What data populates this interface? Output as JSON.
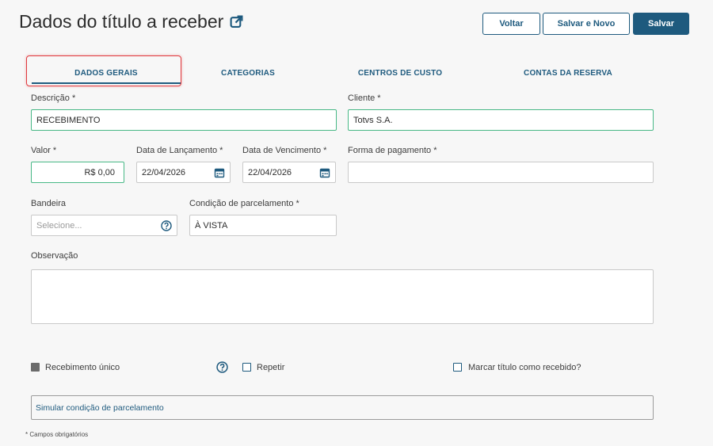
{
  "header": {
    "title": "Dados do título a receber",
    "external_link_icon": "external-link-icon",
    "buttons": {
      "back": "Voltar",
      "save_new": "Salvar e Novo",
      "save": "Salvar"
    }
  },
  "tabs": [
    {
      "label": "DADOS GERAIS",
      "active": true
    },
    {
      "label": "CATEGORIAS",
      "active": false
    },
    {
      "label": "CENTROS DE CUSTO",
      "active": false
    },
    {
      "label": "CONTAS DA RESERVA",
      "active": false
    }
  ],
  "form": {
    "descricao": {
      "label": "Descrição *",
      "value": "RECEBIMENTO"
    },
    "cliente": {
      "label": "Cliente *",
      "value": "Totvs S.A."
    },
    "valor": {
      "label": "Valor *",
      "value": "R$ 0,00"
    },
    "data_lancamento": {
      "label": "Data de Lançamento *",
      "value": "22/04/2026",
      "icon": "calendar-icon"
    },
    "data_vencimento": {
      "label": "Data de Vencimento *",
      "value": "22/04/2026",
      "icon": "calendar-icon"
    },
    "forma_pagamento": {
      "label": "Forma de pagamento *",
      "value": ""
    },
    "bandeira": {
      "label": "Bandeira",
      "placeholder": "Selecione...",
      "icon": "help-icon"
    },
    "condicao": {
      "label": "Condição de parcelamento *",
      "value": "À VISTA"
    },
    "observacao": {
      "label": "Observação",
      "value": ""
    }
  },
  "options": {
    "recebimento_unico": {
      "label": "Recebimento único",
      "checked": true
    },
    "help_icon": "help-icon",
    "repetir": {
      "label": "Repetir",
      "checked": false
    },
    "marcar_recebido": {
      "label": "Marcar título como recebido?",
      "checked": false
    }
  },
  "simulate": {
    "label": "Simular condição de parcelamento"
  },
  "footer": {
    "required_note": "* Campos obrigatórios"
  },
  "colors": {
    "primary": "#1e5a7e",
    "valid_border": "#48b886",
    "highlight": "#e0393e"
  }
}
